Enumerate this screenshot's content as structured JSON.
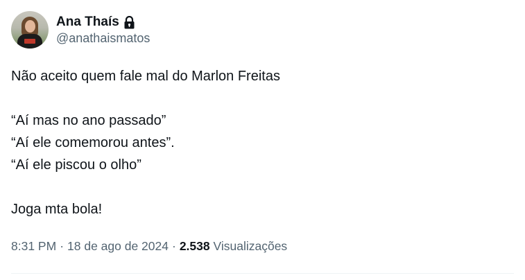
{
  "author": {
    "display_name": "Ana Thaís",
    "handle": "@anathaismatos",
    "protected_icon": "lock-icon",
    "avatar_icon": "avatar"
  },
  "tweet": {
    "lines": [
      "Não aceito quem fale mal do Marlon Freitas",
      "",
      "“Aí mas no ano passado”",
      "“Aí ele comemorou antes”.",
      "“Aí ele piscou o olho”",
      "",
      "Joga mta bola!"
    ]
  },
  "meta": {
    "time": "8:31 PM",
    "date": "18 de ago de 2024",
    "separator": "·",
    "views_count": "2.538",
    "views_label": "Visualizações"
  },
  "colors": {
    "text_primary": "#0f1419",
    "text_secondary": "#536471",
    "divider": "#eff3f4"
  }
}
